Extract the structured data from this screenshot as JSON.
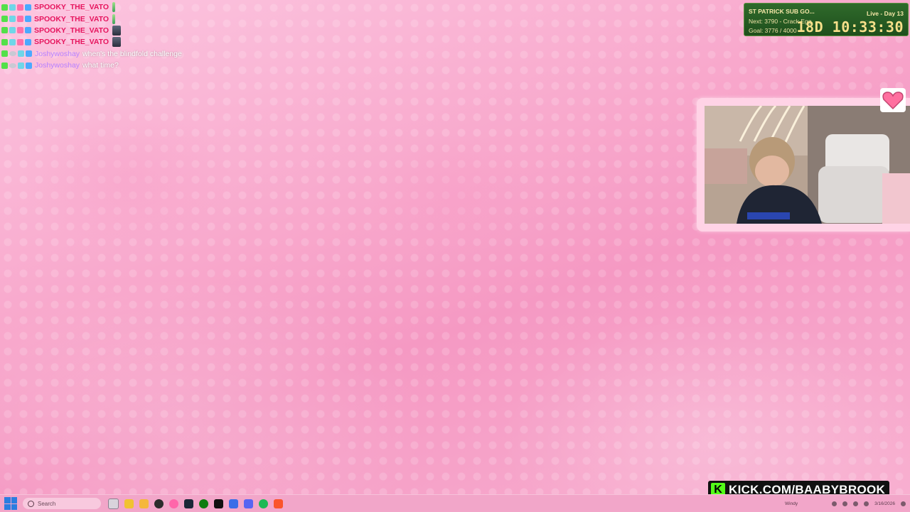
{
  "chat": {
    "messages": [
      {
        "user": "SPOOKY_THE_VATO",
        "text": ""
      },
      {
        "user": "SPOOKY_THE_VATO",
        "text": ""
      },
      {
        "user": "SPOOKY_THE_VATO",
        "text": ""
      },
      {
        "user": "SPOOKY_THE_VATO",
        "text": ""
      },
      {
        "user": "Joshywoshay",
        "text": "when's the blindfold challenge"
      },
      {
        "user": "Joshywoshay",
        "text": "what time?"
      }
    ]
  },
  "subathon": {
    "title": "ST PATRICK SUB GO...",
    "live": "Live - Day 13",
    "next": "Next: 3790 - Crack Egg",
    "goal": "Goal: 3776 / 4000",
    "timer": "18D 10:33:30"
  },
  "banner": {
    "logo": "K",
    "text": "KICK.COM/BAABYBROOK"
  },
  "taskbar": {
    "search_placeholder": "Search",
    "weather": "Windy",
    "date": "3/16/2026",
    "icons": [
      "start-icon",
      "task-view-icon",
      "sticky-notes-icon",
      "file-explorer-icon",
      "obs-icon",
      "osu-icon",
      "steam-icon",
      "xbox-icon",
      "tiktok-icon",
      "stream-tool-icon",
      "discord-icon",
      "spotify-icon",
      "brave-icon"
    ]
  },
  "colors": {
    "accent": "#f599c3",
    "spooky_name": "#e6155e",
    "joshy_name": "#b782ff",
    "kick_green": "#53fc18",
    "widget_green": "#2f6a2b"
  }
}
